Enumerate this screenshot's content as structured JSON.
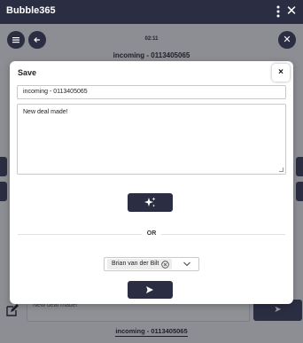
{
  "app": {
    "title": "Bubble365",
    "call_time": "02:11",
    "call_label": "incoming - 0113405065",
    "bottom_note_placeholder": "New deal made!",
    "bottom_call_label": "incoming - 0113405065"
  },
  "modal": {
    "title": "Save",
    "close_label": "×",
    "title_value": "incoming - 0113405065",
    "note_value": "New deal made!",
    "or_label": "OR",
    "assignee": "Brian van der Bilt"
  },
  "colors": {
    "primary": "#2b2d42",
    "overlay": "#8c8e93"
  },
  "icons": [
    "menu-icon",
    "back-arrow-icon",
    "close-icon",
    "more-vert-icon",
    "sparkles-icon",
    "send-icon",
    "edit-icon",
    "chevron-down-icon",
    "remove-chip-icon"
  ]
}
